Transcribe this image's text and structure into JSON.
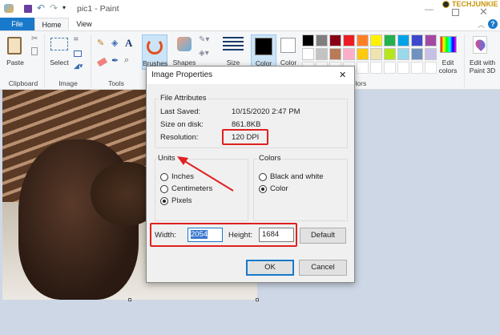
{
  "title": {
    "text": "pic1 - Paint",
    "watermark": "TECHJUNKIE"
  },
  "tabs": {
    "file": "File",
    "home": "Home",
    "view": "View"
  },
  "ribbon": {
    "paste": "Paste",
    "select": "Select",
    "brushes": "Brushes",
    "shapes": "Shapes",
    "size": "Size",
    "color1": "Color",
    "color2": "Color",
    "edit_colors_1": "Edit",
    "edit_colors_2": "colors",
    "edit3d_1": "Edit with",
    "edit3d_2": "Paint 3D",
    "groups": {
      "clipboard": "Clipboard",
      "image": "Image",
      "tools": "Tools",
      "colors": "olors"
    },
    "palette_row1": [
      "#000000",
      "#7f7f7f",
      "#880015",
      "#ed1c24",
      "#ff7f27",
      "#fff200",
      "#22b14c",
      "#00a2e8",
      "#3f48cc",
      "#a349a4"
    ],
    "palette_row2": [
      "#ffffff",
      "#c3c3c3",
      "#b97a57",
      "#ffaec9",
      "#ffc90e",
      "#efe4b0",
      "#b5e61d",
      "#99d9ea",
      "#7092be",
      "#c8bfe7"
    ]
  },
  "dialog": {
    "title": "Image Properties",
    "close": "✕",
    "file_attributes": {
      "legend": "File Attributes",
      "last_saved_label": "Last Saved:",
      "last_saved": "10/15/2020 2:47 PM",
      "size_label": "Size on disk:",
      "size": "861.8KB",
      "resolution_label": "Resolution:",
      "resolution": "120 DPI"
    },
    "units": {
      "legend": "Units",
      "options": [
        "Inches",
        "Centimeters",
        "Pixels"
      ],
      "selected": "Pixels"
    },
    "colors": {
      "legend": "Colors",
      "options": [
        "Black and white",
        "Color"
      ],
      "selected": "Color"
    },
    "width_label": "Width:",
    "width": "2054",
    "height_label": "Height:",
    "height": "1684",
    "default": "Default",
    "ok": "OK",
    "cancel": "Cancel"
  },
  "accent": "#1979ca",
  "annotation_color": "#e02020"
}
